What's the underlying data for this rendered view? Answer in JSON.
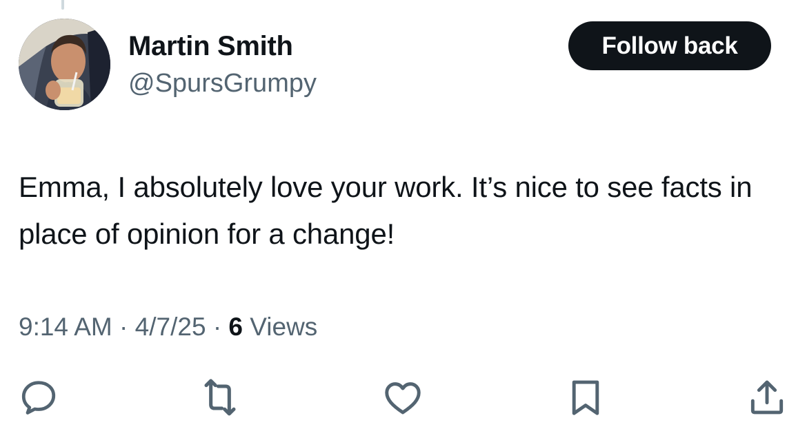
{
  "tweet": {
    "author": {
      "display_name": "Martin Smith",
      "handle": "@SpursGrumpy",
      "avatar": "profile-photo"
    },
    "follow_button_label": "Follow back",
    "text": "Emma, I absolutely love your work. It’s nice to see facts in place of opinion for a change!",
    "time": "9:14 AM",
    "date": "4/7/25",
    "separator": "·",
    "views_count": "6",
    "views_label": "Views"
  },
  "actions": [
    {
      "name": "reply",
      "icon": "reply-icon"
    },
    {
      "name": "repost",
      "icon": "repost-icon"
    },
    {
      "name": "like",
      "icon": "like-icon"
    },
    {
      "name": "bookmark",
      "icon": "bookmark-icon"
    },
    {
      "name": "share",
      "icon": "share-icon"
    }
  ],
  "colors": {
    "text_primary": "#0f1419",
    "text_secondary": "#536471",
    "button_background": "#0f1419",
    "button_text": "#ffffff",
    "thread_line": "#cfd9de"
  }
}
